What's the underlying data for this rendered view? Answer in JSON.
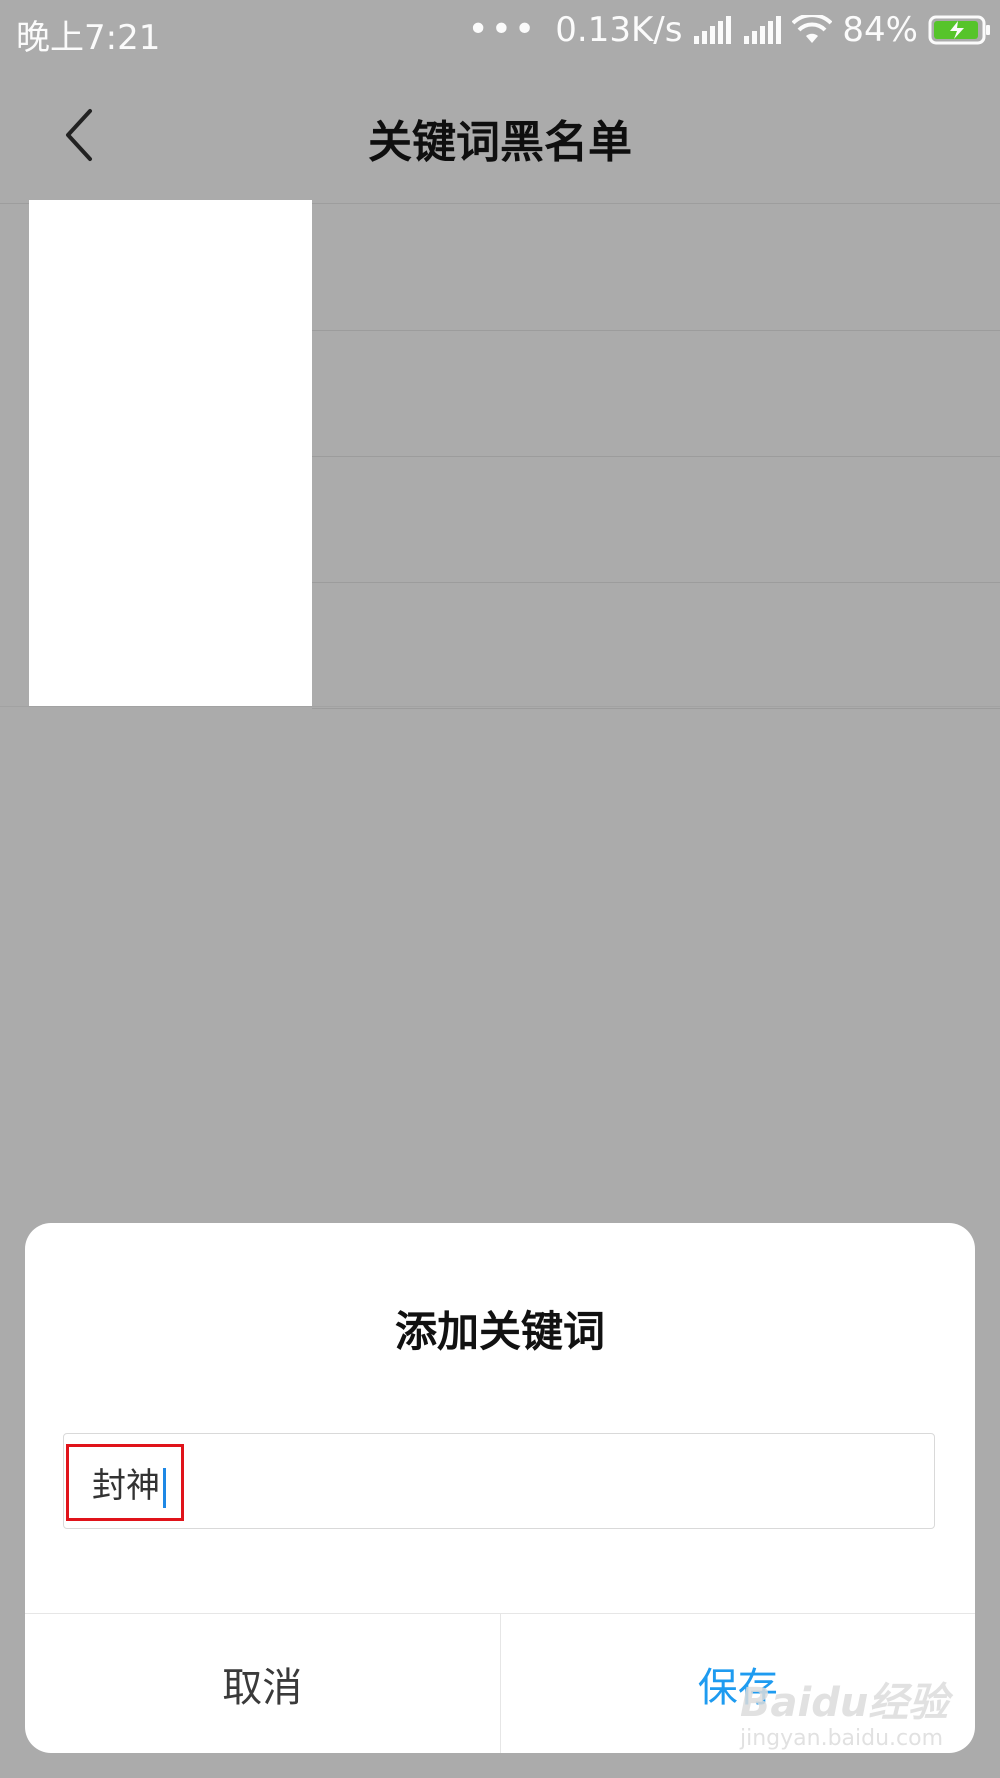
{
  "status_bar": {
    "time": "晚上7:21",
    "dots": "•••",
    "network_speed": "0.13K/s",
    "battery": "84%"
  },
  "header": {
    "title": "关键词黑名单",
    "back_icon": "chevron-left-icon"
  },
  "dialog": {
    "title": "添加关键词",
    "input_value": "封神",
    "cancel_label": "取消",
    "save_label": "保存"
  },
  "watermark": {
    "logo_text": "Baidu经验",
    "url": "jingyan.baidu.com"
  },
  "colors": {
    "accent": "#1e9bf0",
    "highlight_box": "#e0131a",
    "overlay": "#ababab"
  }
}
